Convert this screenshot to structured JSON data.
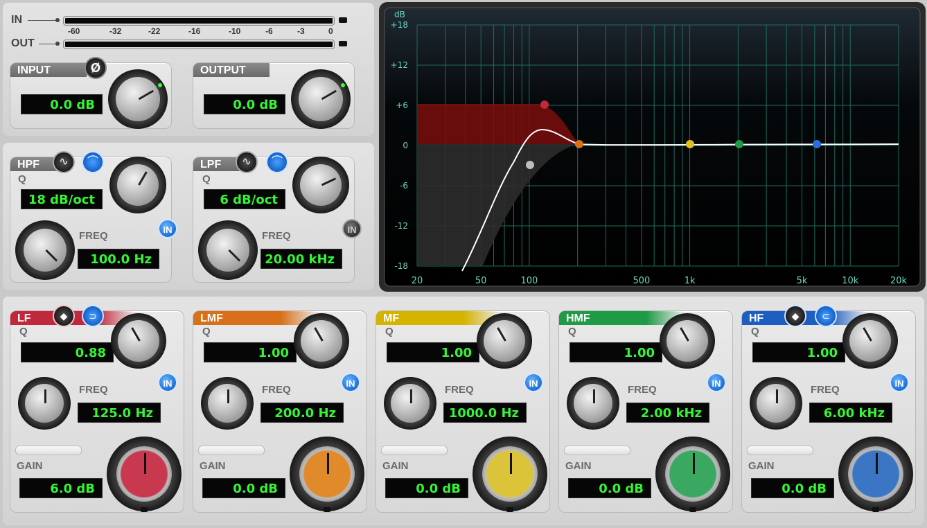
{
  "meter": {
    "in_label": "IN",
    "out_label": "OUT",
    "scale": [
      "-60",
      "-32",
      "-22",
      "-16",
      "-10",
      "-6",
      "-3",
      "0"
    ]
  },
  "input": {
    "title": "INPUT",
    "phase_symbol": "Ø",
    "value": "0.0 dB"
  },
  "output": {
    "title": "OUTPUT",
    "value": "0.0 dB"
  },
  "hpf": {
    "title": "HPF",
    "q_label": "Q",
    "q_value": "18 dB/oct",
    "freq_label": "FREQ",
    "freq_value": "100.0 Hz",
    "in_label": "IN"
  },
  "lpf": {
    "title": "LPF",
    "q_label": "Q",
    "q_value": "6 dB/oct",
    "freq_label": "FREQ",
    "freq_value": "20.00 kHz",
    "in_label": "IN"
  },
  "bands": [
    {
      "title": "LF",
      "color": "#c0283c",
      "q_label": "Q",
      "q_value": "0.88",
      "freq_label": "FREQ",
      "freq_value": "125.0 Hz",
      "gain_label": "GAIN",
      "gain_value": "6.0 dB",
      "in_label": "IN",
      "cap": "#c8384e"
    },
    {
      "title": "LMF",
      "color": "#d8701a",
      "q_label": "Q",
      "q_value": "1.00",
      "freq_label": "FREQ",
      "freq_value": "200.0 Hz",
      "gain_label": "GAIN",
      "gain_value": "0.0 dB",
      "in_label": "IN",
      "cap": "#e08a2c"
    },
    {
      "title": "MF",
      "color": "#d4b400",
      "q_label": "Q",
      "q_value": "1.00",
      "freq_label": "FREQ",
      "freq_value": "1000.0 Hz",
      "gain_label": "GAIN",
      "gain_value": "0.0 dB",
      "in_label": "IN",
      "cap": "#dcc43a"
    },
    {
      "title": "HMF",
      "color": "#1f9a45",
      "q_label": "Q",
      "q_value": "1.00",
      "freq_label": "FREQ",
      "freq_value": "2.00 kHz",
      "gain_label": "GAIN",
      "gain_value": "0.0 dB",
      "in_label": "IN",
      "cap": "#3aa860"
    },
    {
      "title": "HF",
      "color": "#1d5fc0",
      "q_label": "Q",
      "q_value": "1.00",
      "freq_label": "FREQ",
      "freq_value": "6.00 kHz",
      "gain_label": "GAIN",
      "gain_value": "0.0 dB",
      "in_label": "IN",
      "cap": "#3a76c4"
    }
  ],
  "graph": {
    "db_unit": "dB",
    "db_ticks": [
      "+18",
      "+12",
      "+6",
      "0",
      "-6",
      "-12",
      "-18"
    ],
    "freq_ticks": [
      "20",
      "50",
      "100",
      "500",
      "1k",
      "5k",
      "10k",
      "20k"
    ],
    "colors": {
      "curve": "#ffffff",
      "grid": "#1f6b5f",
      "lf_fill": "#7a0d0d"
    }
  }
}
